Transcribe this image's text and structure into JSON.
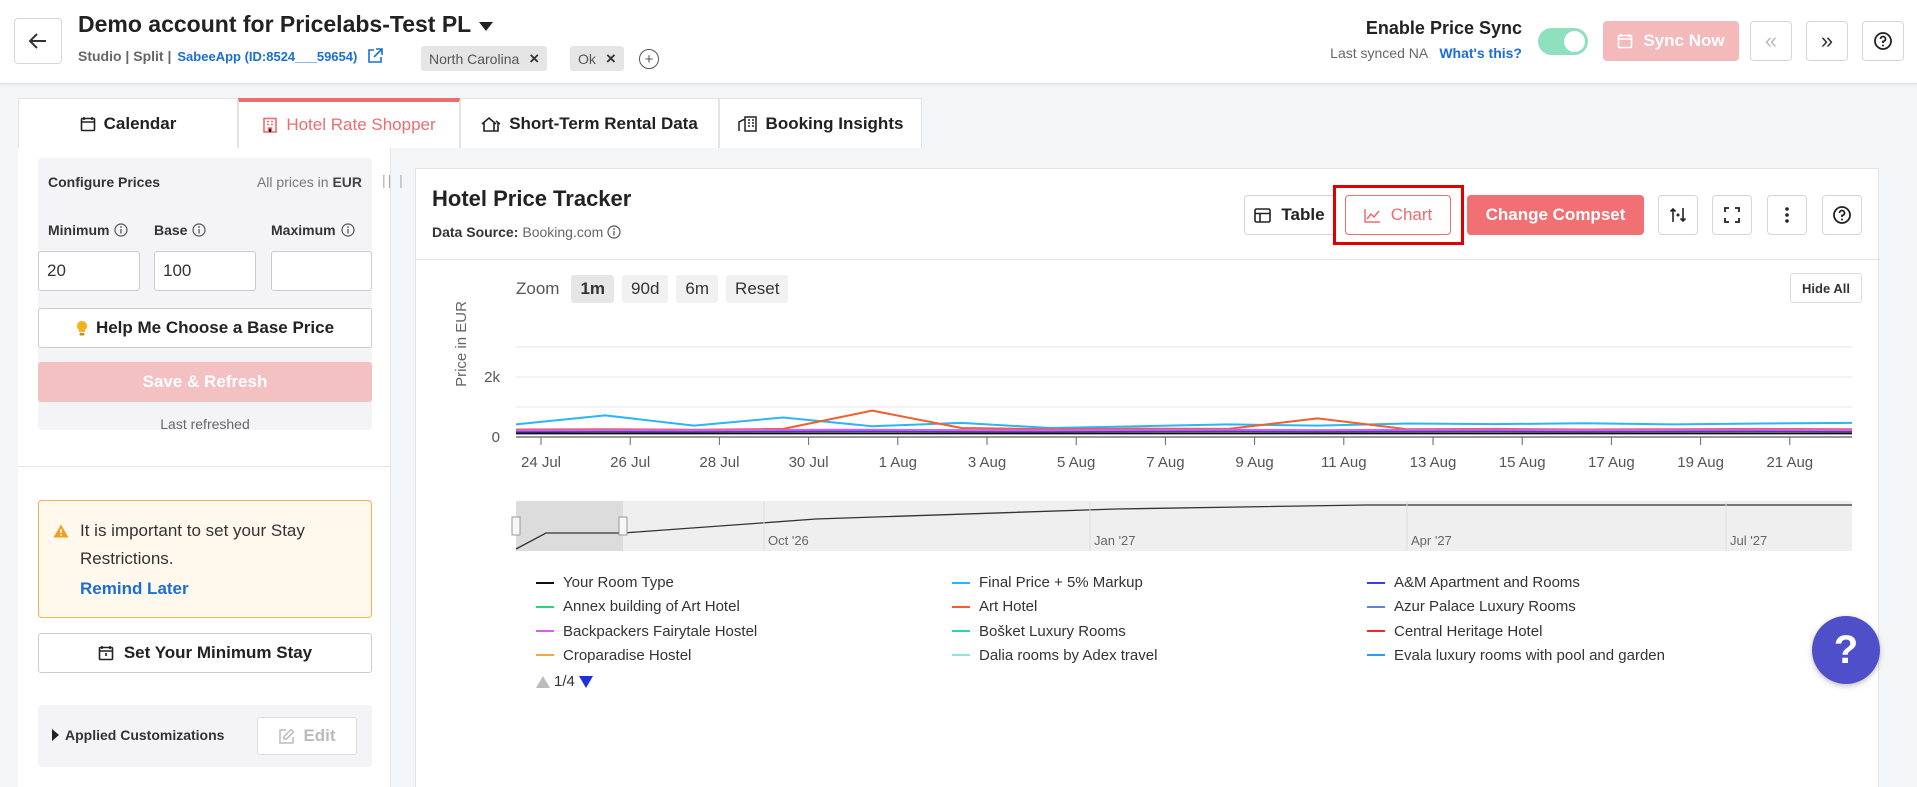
{
  "header": {
    "account_title": "Demo account for Pricelabs-Test PL",
    "account_type": "Studio | Split |",
    "app_id": "SabeeApp (ID:8524___59654)",
    "tags": [
      "North Carolina",
      "Ok"
    ],
    "sync_label": "Enable Price Sync",
    "last_synced": "Last synced NA",
    "whats_this": "What's this?",
    "sync_now_label": "Sync Now",
    "sync_enabled": true
  },
  "tabs": [
    {
      "label": "Calendar",
      "icon": "calendar-icon",
      "active": false
    },
    {
      "label": "Hotel Rate Shopper",
      "icon": "hotel-icon",
      "active": true
    },
    {
      "label": "Short-Term Rental Data",
      "icon": "house-icon",
      "active": false
    },
    {
      "label": "Booking Insights",
      "icon": "building-icon",
      "active": false
    }
  ],
  "config": {
    "heading": "Configure Prices",
    "note_prefix": "All prices in",
    "currency": "EUR",
    "minimum_label": "Minimum",
    "base_label": "Base",
    "maximum_label": "Maximum",
    "minimum_value": "20",
    "base_value": "100",
    "maximum_value": "",
    "help_button": "Help Me Choose a Base Price",
    "save_button": "Save & Refresh",
    "last_refreshed": "Last refreshed"
  },
  "warning": {
    "text": "It is important to set your Stay Restrictions.",
    "link": "Remind Later"
  },
  "min_stay_button": "Set Your Minimum Stay",
  "customizations": {
    "label": "Applied Customizations",
    "edit": "Edit"
  },
  "tracker": {
    "title": "Hotel Price Tracker",
    "source_label": "Data Source:",
    "source_value": "Booking.com",
    "table_label": "Table",
    "chart_label": "Chart",
    "compset_label": "Change Compset",
    "active_view": "Chart"
  },
  "zoom": {
    "label": "Zoom",
    "options": [
      "1m",
      "90d",
      "6m",
      "Reset"
    ],
    "active": "1m"
  },
  "hide_all": "Hide All",
  "chart_data": {
    "type": "line",
    "ylabel": "Price in EUR",
    "y_ticks": [
      "0",
      "2k"
    ],
    "x_ticks": [
      "24 Jul",
      "26 Jul",
      "28 Jul",
      "30 Jul",
      "1 Aug",
      "3 Aug",
      "5 Aug",
      "7 Aug",
      "9 Aug",
      "11 Aug",
      "13 Aug",
      "15 Aug",
      "17 Aug",
      "19 Aug",
      "21 Aug"
    ],
    "navigator_ticks": [
      "Oct '26",
      "Jan '27",
      "Apr '27",
      "Jul '27"
    ],
    "ylim": [
      0,
      4000
    ],
    "grid": true,
    "legend_position": "bottom",
    "series": [
      {
        "name": "Your Room Type",
        "color": "#111111",
        "values": [
          120,
          120,
          120,
          120,
          120,
          120,
          120,
          120,
          120,
          120,
          120,
          120,
          120,
          120,
          120,
          120
        ]
      },
      {
        "name": "Final Price + 5% Markup",
        "color": "#2bb5f5",
        "values": [
          420,
          720,
          380,
          650,
          360,
          470,
          300,
          360,
          420,
          380,
          450,
          430,
          460,
          420,
          450,
          470
        ]
      },
      {
        "name": "Art Hotel",
        "color": "#f25f2c",
        "values": [
          250,
          260,
          240,
          270,
          880,
          300,
          260,
          280,
          270,
          620,
          260,
          270,
          250,
          260,
          270,
          260
        ]
      },
      {
        "name": "A&M Apartment and Rooms",
        "color": "#3b3fd6",
        "values": [
          180,
          190,
          185,
          195,
          200,
          190,
          185,
          195,
          200,
          190,
          195,
          200,
          190,
          195,
          200,
          190
        ]
      },
      {
        "name": "Backpackers Fairytale Hostel",
        "color": "#d65ee8",
        "values": [
          220,
          230,
          225,
          235,
          240,
          230,
          225,
          235,
          240,
          230,
          235,
          240,
          230,
          235,
          240,
          230
        ]
      }
    ],
    "legend": [
      {
        "name": "Your Room Type",
        "color": "#111111"
      },
      {
        "name": "Final Price + 5% Markup",
        "color": "#2bb5f5"
      },
      {
        "name": "A&M Apartment and Rooms",
        "color": "#3b3fd6"
      },
      {
        "name": "Annex building of Art Hotel",
        "color": "#2fd17c"
      },
      {
        "name": "Art Hotel",
        "color": "#f25f2c"
      },
      {
        "name": "Azur Palace Luxury Rooms",
        "color": "#5a86d6"
      },
      {
        "name": "Backpackers Fairytale Hostel",
        "color": "#d65ee8"
      },
      {
        "name": "Bošket Luxury Rooms",
        "color": "#2ed1b8"
      },
      {
        "name": "Central Heritage Hotel",
        "color": "#ee2a2a"
      },
      {
        "name": "Croparadise Hostel",
        "color": "#f5a44a"
      },
      {
        "name": "Dalia rooms by Adex travel",
        "color": "#8fe6e0"
      },
      {
        "name": "Evala luxury rooms with pool and garden",
        "color": "#2b9df5"
      }
    ],
    "legend_page": "1/4"
  }
}
